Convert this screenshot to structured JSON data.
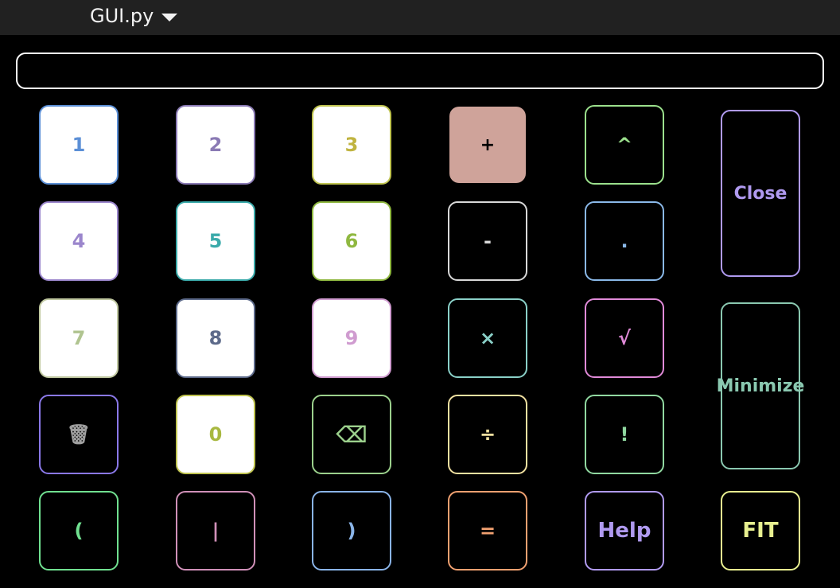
{
  "window": {
    "title": "GUI.py"
  },
  "display": {
    "value": ""
  },
  "buttons": {
    "b1": {
      "label": "1",
      "color": "#5b8fd6"
    },
    "b2": {
      "label": "2",
      "color": "#8a7ab4"
    },
    "b3": {
      "label": "3",
      "color": "#c0b440"
    },
    "plus": {
      "label": "+",
      "color": "#000000",
      "bg": "#cfa39a"
    },
    "pow": {
      "label": "^",
      "color": "#9be08c"
    },
    "close": {
      "label": "Close",
      "color": "#b09af0"
    },
    "b4": {
      "label": "4",
      "color": "#9b86cc"
    },
    "b5": {
      "label": "5",
      "color": "#3aaaaa"
    },
    "b6": {
      "label": "6",
      "color": "#8fb840"
    },
    "minus": {
      "label": "-",
      "color": "#d8d8d8"
    },
    "dot": {
      "label": ".",
      "color": "#8ab8e8"
    },
    "minimize": {
      "label": "Minimize",
      "color": "#8ac8b0"
    },
    "b7": {
      "label": "7",
      "color": "#b0c490"
    },
    "b8": {
      "label": "8",
      "color": "#5d6a8a"
    },
    "b9": {
      "label": "9",
      "color": "#d09cd0"
    },
    "times": {
      "label": "×",
      "color": "#8ad0c8"
    },
    "sqrt": {
      "label": "√",
      "color": "#e08ad8"
    },
    "trash": {
      "label": "🗑",
      "color": "#a0a0a0"
    },
    "b0": {
      "label": "0",
      "color": "#a8b840"
    },
    "backspace": {
      "label": "⌫",
      "color": "#9bd08c"
    },
    "divide": {
      "label": "÷",
      "color": "#f0e0a0"
    },
    "fact": {
      "label": "!",
      "color": "#90d8a0"
    },
    "lparen": {
      "label": "(",
      "color": "#70e090"
    },
    "pipe": {
      "label": "|",
      "color": "#d090b8"
    },
    "rparen": {
      "label": ")",
      "color": "#8ab4e8"
    },
    "equals": {
      "label": "=",
      "color": "#f0a070"
    },
    "help": {
      "label": "Help",
      "color": "#b09af0"
    },
    "fit": {
      "label": "FIT",
      "color": "#e8f090"
    }
  }
}
